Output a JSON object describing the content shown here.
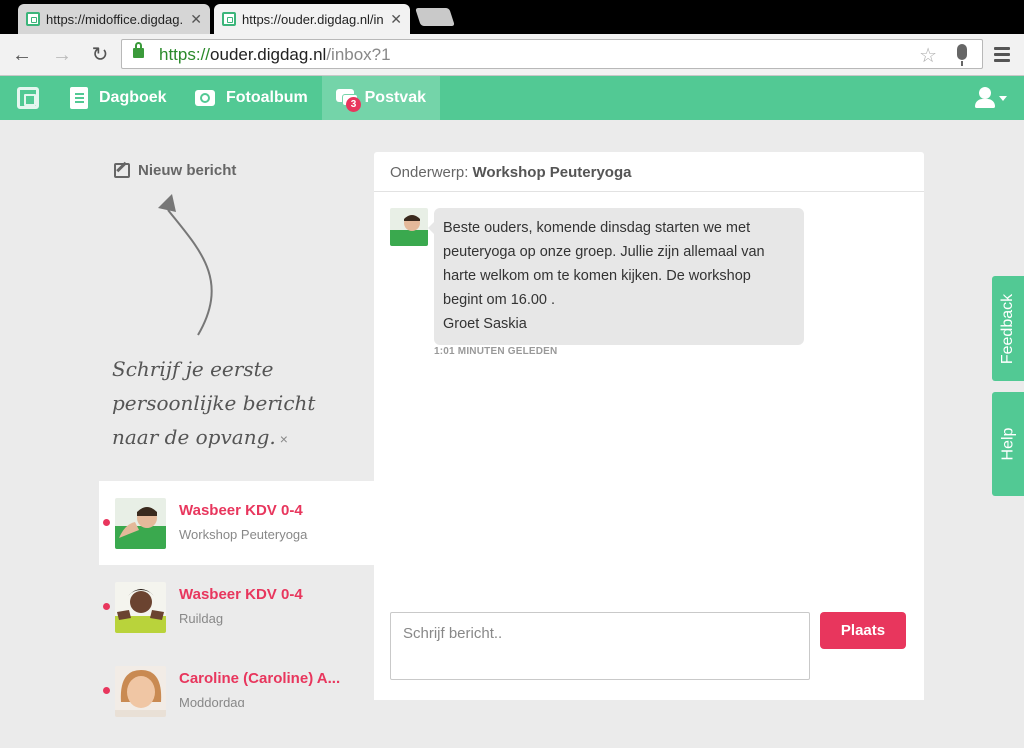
{
  "browser": {
    "tabs": [
      {
        "title": "https://midoffice.digdag.nl",
        "active": false
      },
      {
        "title": "https://ouder.digdag.nl/inb",
        "active": true
      }
    ],
    "url_scheme": "https://",
    "url_host": "ouder.digdag.nl",
    "url_path": "/inbox?1"
  },
  "nav": {
    "items": [
      {
        "label": "Dagboek",
        "icon": "book-icon"
      },
      {
        "label": "Fotoalbum",
        "icon": "camera-icon"
      },
      {
        "label": "Postvak",
        "icon": "chat-icon",
        "badge": "3"
      }
    ]
  },
  "sidebar": {
    "new_message": "Nieuw bericht",
    "hint_lines": [
      "Schrijf je eerste",
      "persoonlijke bericht",
      "naar de opvang."
    ],
    "hint_close": "×",
    "conversations": [
      {
        "name": "Wasbeer KDV 0-4",
        "subject": "Workshop Peuteryoga",
        "unread": true,
        "selected": true
      },
      {
        "name": "Wasbeer KDV 0-4",
        "subject": "Ruildag",
        "unread": true,
        "selected": false
      },
      {
        "name": "Caroline (Caroline) A...",
        "subject": "Moddordag",
        "unread": true,
        "selected": false
      }
    ]
  },
  "message": {
    "subject_label": "Onderwerp:",
    "subject": "Workshop Peuteryoga",
    "body_lines": [
      "Beste ouders, komende dinsdag starten we met",
      "peuteryoga op onze groep. Jullie zijn allemaal van",
      "harte welkom om te komen kijken. De workshop",
      "begint om 16.00 .",
      "Groet Saskia"
    ],
    "time": "1:01 MINUTEN GELEDEN",
    "compose_placeholder": "Schrijf bericht..",
    "send_label": "Plaats"
  },
  "side_tabs": {
    "feedback": "Feedback",
    "help": "Help"
  },
  "colors": {
    "brand_green": "#52c994",
    "accent_red": "#e8365d"
  }
}
